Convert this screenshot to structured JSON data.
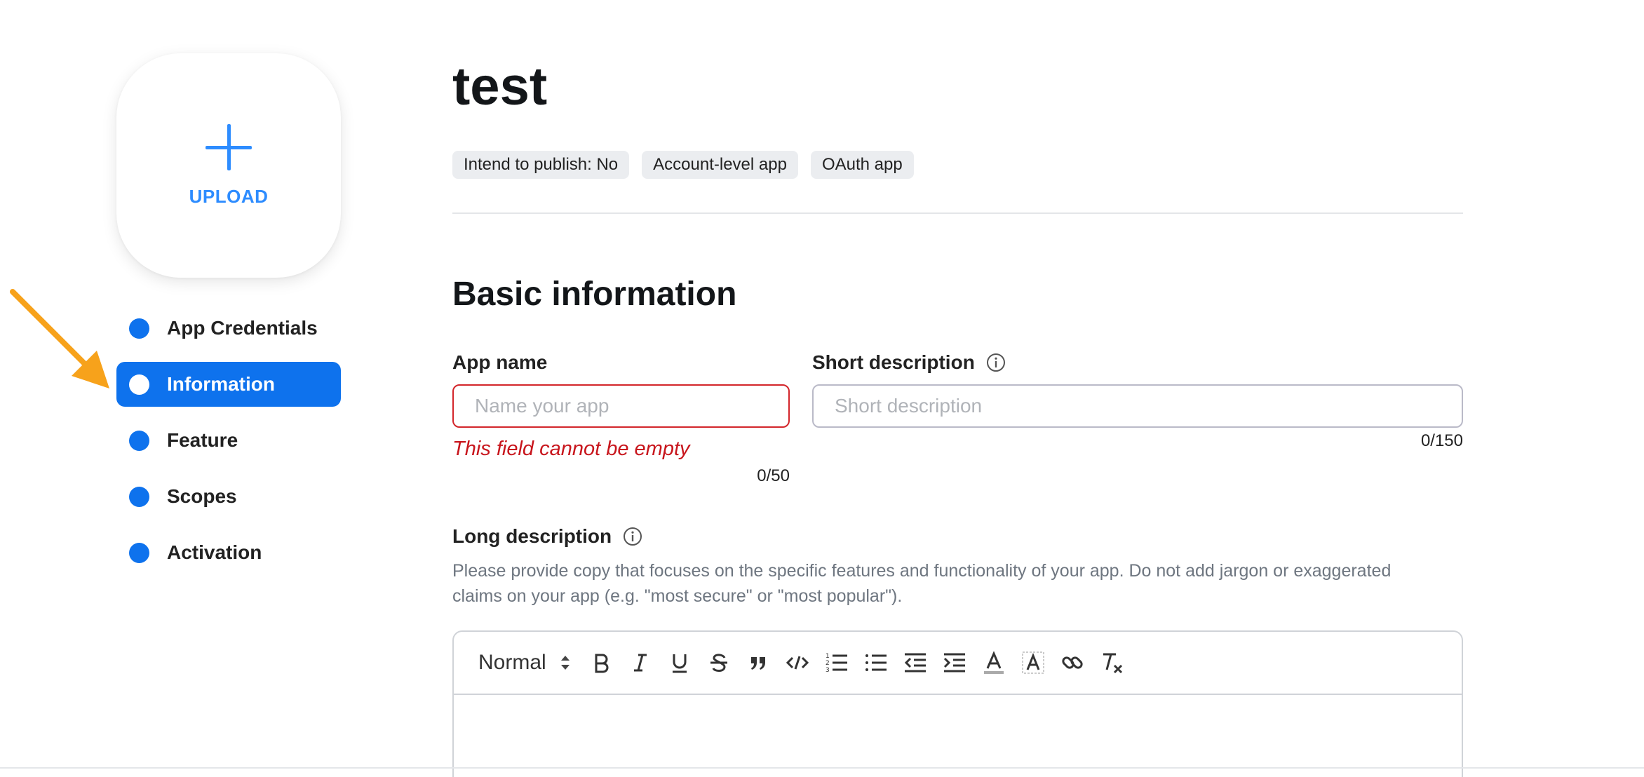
{
  "app": {
    "title": "test",
    "tags": [
      "Intend to publish: No",
      "Account-level app",
      "OAuth app"
    ]
  },
  "upload": {
    "label": "UPLOAD"
  },
  "nav": {
    "items": [
      {
        "label": "App Credentials",
        "active": false
      },
      {
        "label": "Information",
        "active": true
      },
      {
        "label": "Feature",
        "active": false
      },
      {
        "label": "Scopes",
        "active": false
      },
      {
        "label": "Activation",
        "active": false
      }
    ]
  },
  "basic_info": {
    "section_title": "Basic information",
    "app_name": {
      "label": "App name",
      "placeholder": "Name your app",
      "value": "",
      "error": "This field cannot be empty",
      "counter": "0/50"
    },
    "short_description": {
      "label": "Short description",
      "placeholder": "Short description",
      "value": "",
      "counter": "0/150"
    },
    "long_description": {
      "label": "Long description",
      "help": "Please provide copy that focuses on the specific features and functionality of your app. Do not add jargon or exaggerated claims on your app (e.g. \"most secure\" or \"most popular\").",
      "format": "Normal"
    }
  },
  "colors": {
    "accent": "#0e72ed",
    "upload_blue": "#2d8cff",
    "error": "#c8161d",
    "annotation_arrow": "#f7a21b"
  },
  "icons": {
    "toolbar": [
      "bold-icon",
      "italic-icon",
      "underline-icon",
      "strikethrough-icon",
      "blockquote-icon",
      "code-icon",
      "ordered-list-icon",
      "bullet-list-icon",
      "outdent-icon",
      "indent-icon",
      "text-color-icon",
      "background-color-icon",
      "link-icon",
      "clear-format-icon"
    ]
  }
}
